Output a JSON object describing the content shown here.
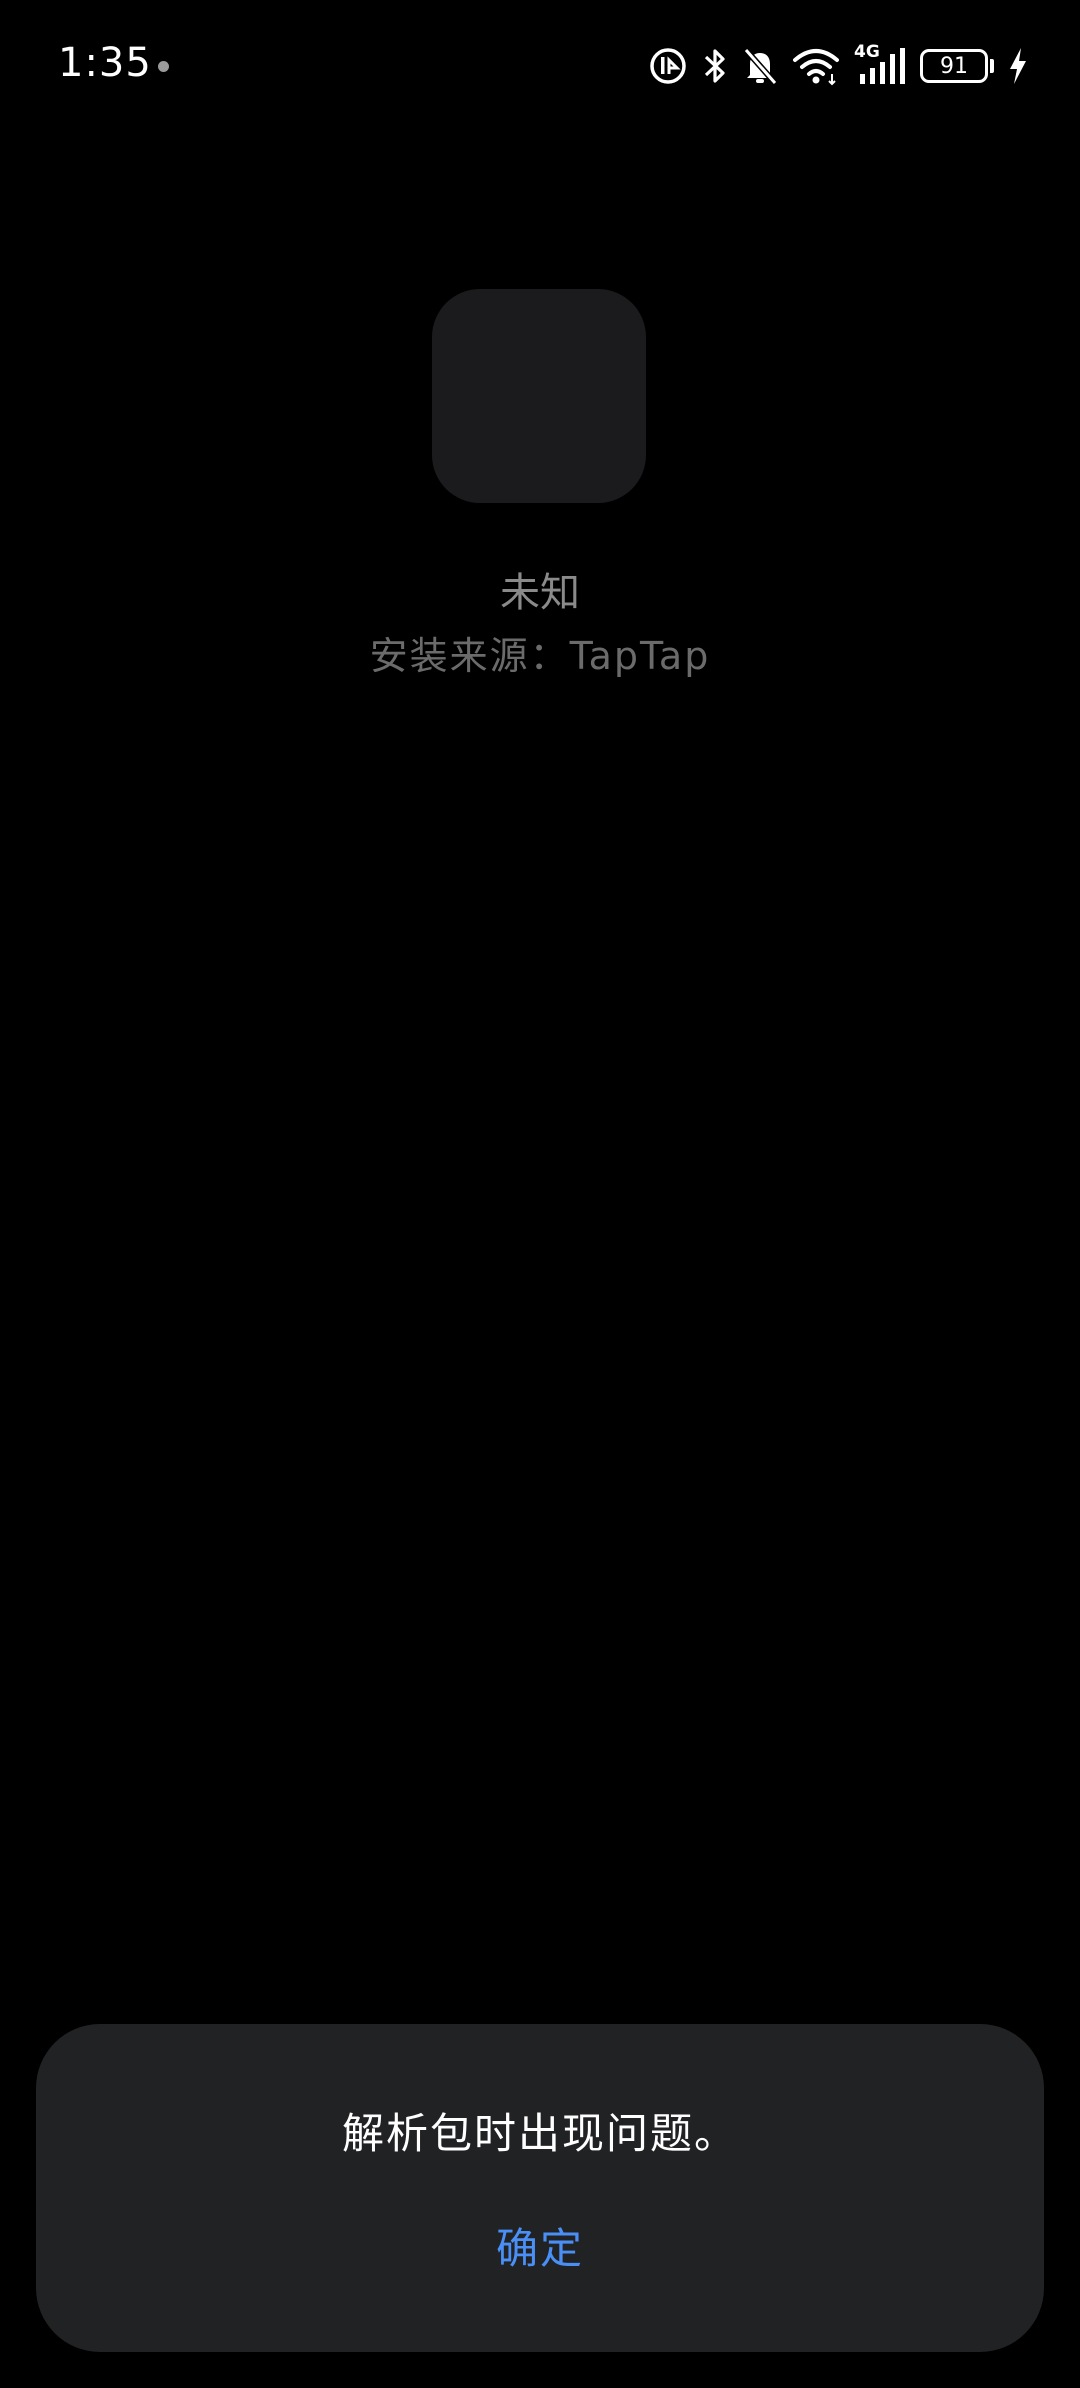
{
  "status_bar": {
    "time": "1:35",
    "battery_level": "91",
    "network_label": "4G",
    "icons": [
      "notification-dot-icon",
      "sim-badge-icon",
      "bluetooth-icon",
      "bell-muted-icon",
      "wifi-icon",
      "cellular-signal-icon",
      "battery-icon",
      "charging-bolt-icon"
    ]
  },
  "app": {
    "name": "未知",
    "install_source": "安装来源：TapTap"
  },
  "dialog": {
    "message": "解析包时出现问题。",
    "confirm_label": "确定",
    "accent_color": "#4a8ff5"
  }
}
